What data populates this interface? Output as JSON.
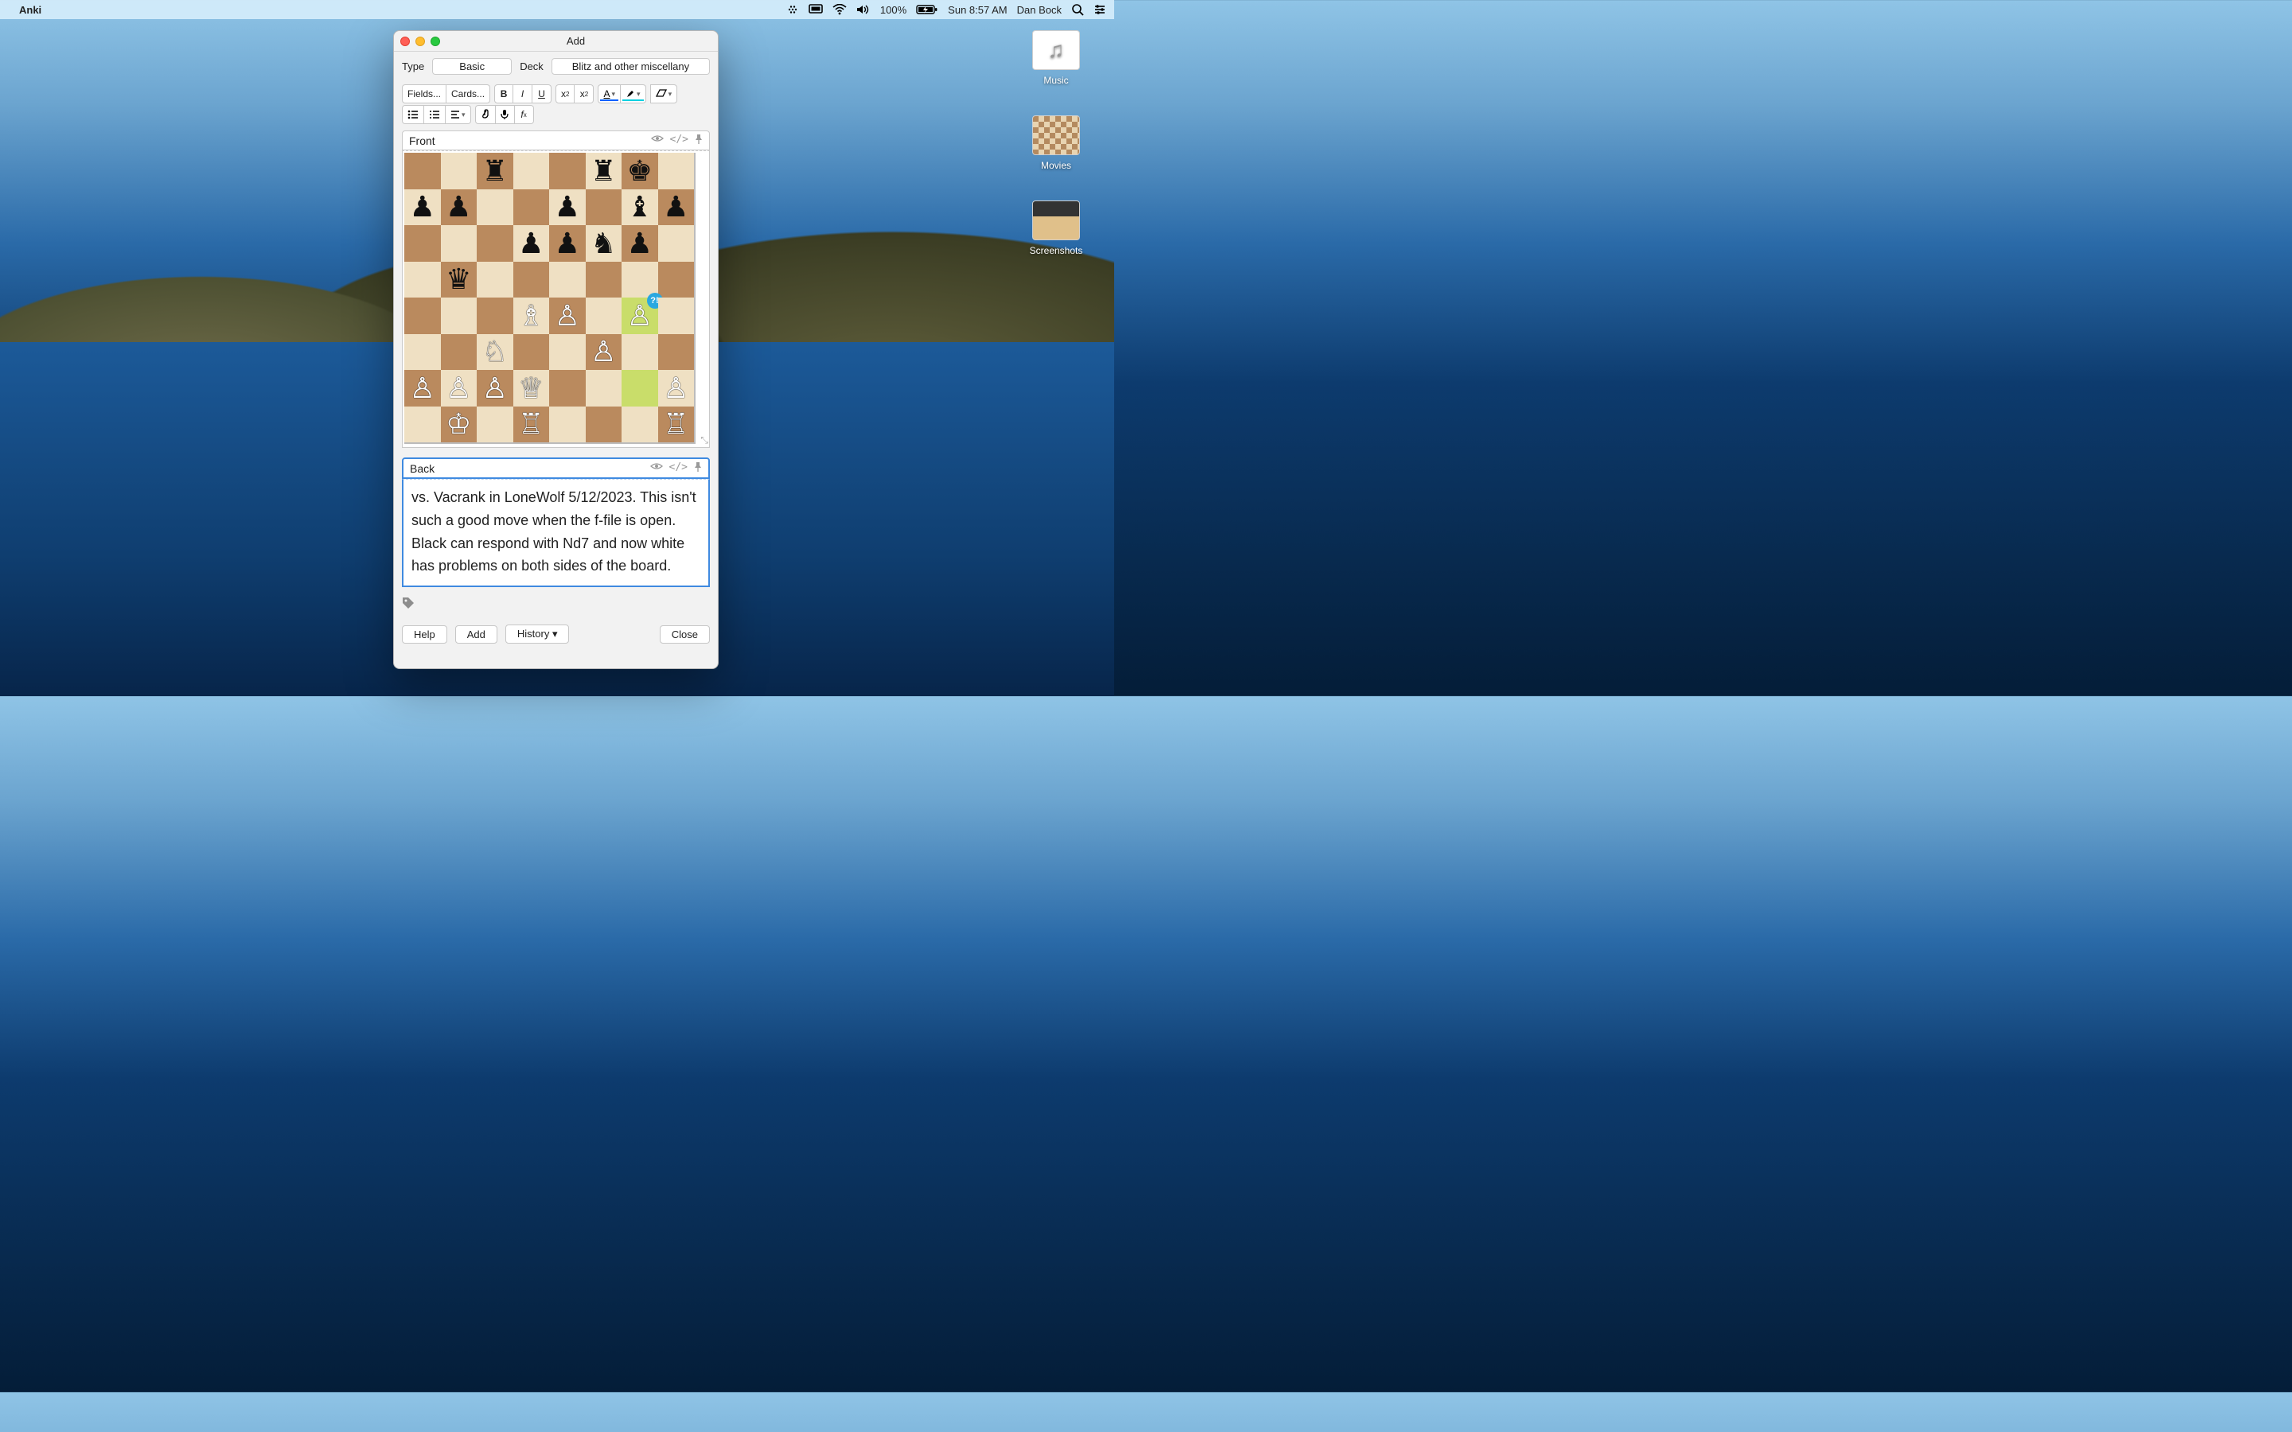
{
  "menubar": {
    "app_name": "Anki",
    "battery_pct": "100%",
    "clock": "Sun 8:57 AM",
    "user": "Dan Bock"
  },
  "desktop": {
    "music": "Music",
    "movies": "Movies",
    "screenshots": "Screenshots"
  },
  "window": {
    "title": "Add",
    "type_label": "Type",
    "type_value": "Basic",
    "deck_label": "Deck",
    "deck_value": "Blitz and other miscellany",
    "fields_btn": "Fields...",
    "cards_btn": "Cards...",
    "front_label": "Front",
    "back_label": "Back",
    "back_text": "vs. Vacrank in LoneWolf 5/12/2023. This isn't such a good move when the f-file is open. Black can respond with Nd7 and now white has problems on both sides of the board.",
    "help_btn": "Help",
    "add_btn": "Add",
    "history_btn": "History ▾",
    "close_btn": "Close"
  },
  "chess": {
    "annotation": "?!",
    "highlight_squares": [
      "g4",
      "g2"
    ],
    "pieces": [
      {
        "sq": "c8",
        "g": "♜"
      },
      {
        "sq": "f8",
        "g": "♜"
      },
      {
        "sq": "g8",
        "g": "♚"
      },
      {
        "sq": "a7",
        "g": "♟"
      },
      {
        "sq": "b7",
        "g": "♟"
      },
      {
        "sq": "e7",
        "g": "♟"
      },
      {
        "sq": "g7",
        "g": "♝"
      },
      {
        "sq": "h7",
        "g": "♟"
      },
      {
        "sq": "d6",
        "g": "♟"
      },
      {
        "sq": "e6",
        "g": "♟"
      },
      {
        "sq": "f6",
        "g": "♞"
      },
      {
        "sq": "g6",
        "g": "♟"
      },
      {
        "sq": "b5",
        "g": "♛"
      },
      {
        "sq": "d4",
        "g": "♗"
      },
      {
        "sq": "e4",
        "g": "♙"
      },
      {
        "sq": "g4",
        "g": "♙"
      },
      {
        "sq": "c3",
        "g": "♘"
      },
      {
        "sq": "f3",
        "g": "♙"
      },
      {
        "sq": "a2",
        "g": "♙"
      },
      {
        "sq": "b2",
        "g": "♙"
      },
      {
        "sq": "c2",
        "g": "♙"
      },
      {
        "sq": "d2",
        "g": "♕"
      },
      {
        "sq": "h2",
        "g": "♙"
      },
      {
        "sq": "b1",
        "g": "♔"
      },
      {
        "sq": "d1",
        "g": "♖"
      },
      {
        "sq": "h1",
        "g": "♖"
      }
    ]
  }
}
